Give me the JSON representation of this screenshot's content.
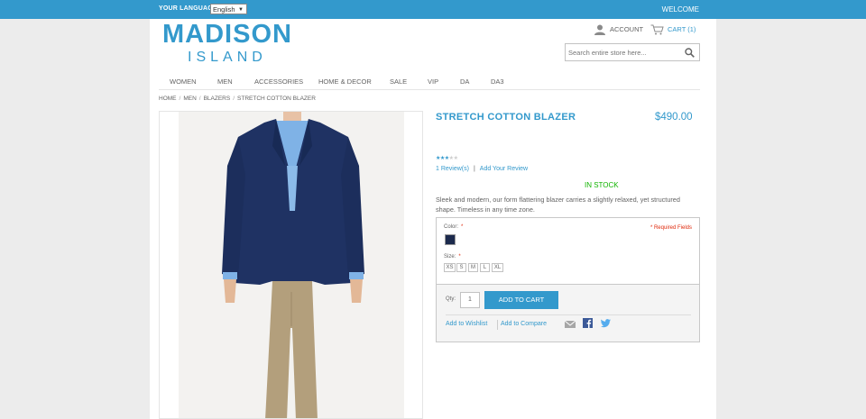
{
  "topbar": {
    "language_label": "YOUR LANGUAGE:",
    "language_value": "English",
    "welcome": "WELCOME"
  },
  "logo": {
    "line1": "MADISON",
    "line2": "ISLAND"
  },
  "header": {
    "account_label": "ACCOUNT",
    "cart_label": "CART (1)",
    "search_placeholder": "Search entire store here..."
  },
  "nav": {
    "items": [
      "WOMEN",
      "MEN",
      "ACCESSORIES",
      "HOME & DECOR",
      "SALE",
      "VIP",
      "DA",
      "DA3"
    ]
  },
  "breadcrumb": [
    "HOME",
    "MEN",
    "BLAZERS",
    "STRETCH COTTON BLAZER"
  ],
  "product": {
    "name": "STRETCH COTTON BLAZER",
    "price": "$490.00",
    "rating_stars": 3,
    "rating_max": 5,
    "reviews_label": "1 Review(s)",
    "add_review_label": "Add Your Review",
    "availability": "IN STOCK",
    "description": "Sleek and modern, our form flattering blazer carries a slightly relaxed, yet structured shape. Timeless in any time zone."
  },
  "options": {
    "color_label": "Color:",
    "size_label": "Size:",
    "required_asterisk": "*",
    "required_note": "* Required Fields",
    "color_swatch": "#1c2a4d",
    "sizes": [
      "XS",
      "S",
      "M",
      "L",
      "XL"
    ]
  },
  "cart": {
    "qty_label": "Qty:",
    "qty_value": "1",
    "add_to_cart": "ADD TO CART",
    "wishlist": "Add to Wishlist",
    "compare": "Add to Compare",
    "share_icons": [
      "mail-icon",
      "facebook-icon",
      "twitter-icon"
    ]
  },
  "colors": {
    "accent": "#3399cc",
    "in_stock": "#11b400",
    "required": "#df280a",
    "blazer": "#1f3263",
    "pants": "#b39f7c"
  }
}
